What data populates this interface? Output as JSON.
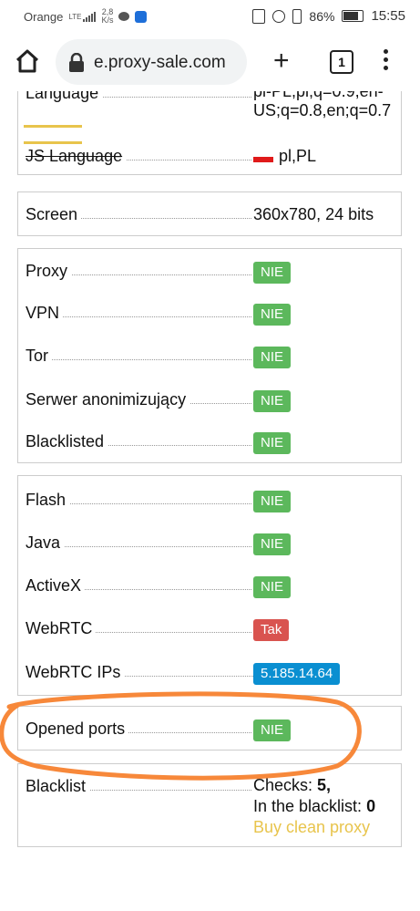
{
  "status_bar": {
    "carrier": "Orange",
    "net_type": "LTE",
    "net_speed_value": "2,8",
    "net_speed_unit": "K/s",
    "battery": "86%",
    "time": "15:55"
  },
  "browser": {
    "url": "e.proxy-sale.com",
    "tab_count": "1"
  },
  "sections": {
    "language_top": {
      "label": "Language",
      "value_line1": "pl-PL,pl;q=0.9,en-",
      "value_line2": "US;q=0.8,en;q=0.7",
      "js_label": "JS Language",
      "js_value": "pl,PL"
    },
    "screen": {
      "label": "Screen",
      "value": "360x780, 24 bits"
    },
    "anonymity": [
      {
        "label": "Proxy",
        "value": "NIE",
        "color": "#5cb85c"
      },
      {
        "label": "VPN",
        "value": "NIE",
        "color": "#5cb85c"
      },
      {
        "label": "Tor",
        "value": "NIE",
        "color": "#5cb85c"
      },
      {
        "label": "Serwer anonimizujący",
        "value": "NIE",
        "color": "#5cb85c"
      },
      {
        "label": "Blacklisted",
        "value": "NIE",
        "color": "#5cb85c"
      }
    ],
    "plugins": [
      {
        "label": "Flash",
        "value": "NIE",
        "color": "#5cb85c"
      },
      {
        "label": "Java",
        "value": "NIE",
        "color": "#5cb85c"
      },
      {
        "label": "ActiveX",
        "value": "NIE",
        "color": "#5cb85c"
      },
      {
        "label": "WebRTC",
        "value": "Tak",
        "color": "#d9534f"
      },
      {
        "label": "WebRTC IPs",
        "value": "5.185.14.64",
        "color": "#0a8fd1"
      }
    ],
    "ports": {
      "label": "Opened ports",
      "value": "NIE"
    },
    "blacklist": {
      "label": "Blacklist",
      "checks_label": "Checks:",
      "checks_value": "5,",
      "in_blacklist_label": "In the blacklist:",
      "in_blacklist_value": "0",
      "buy_link": "Buy clean proxy"
    }
  },
  "annotation_color": "#f7883a",
  "highlight_color": "#e8c44c"
}
